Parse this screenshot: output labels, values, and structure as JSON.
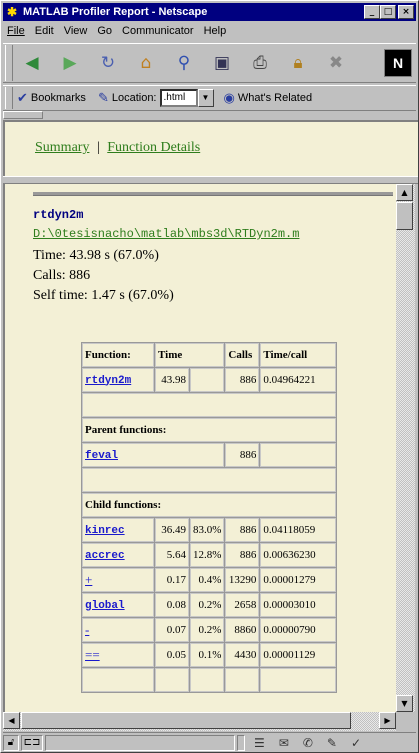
{
  "window": {
    "title": "MATLAB Profiler Report - Netscape"
  },
  "menu": [
    "File",
    "Edit",
    "View",
    "Go",
    "Communicator",
    "Help"
  ],
  "toolbar": {
    "icons": [
      "back-icon",
      "forward-icon",
      "reload-icon",
      "home-icon",
      "search-icon",
      "netscape-guide-icon",
      "print-icon",
      "security-icon",
      "stop-icon"
    ],
    "netscape_logo": "N"
  },
  "location_bar": {
    "bookmarks_label": "Bookmarks",
    "location_label": "Location:",
    "location_value": ".html",
    "whats_related_label": "What's Related"
  },
  "nav_links": {
    "summary": "Summary",
    "separator": "|",
    "function_details": "Function Details"
  },
  "function": {
    "name": "rtdyn2m",
    "path": "D:\\0tesisnacho\\matlab\\mbs3d\\RTDyn2m.m",
    "time_line": "Time: 43.98 s   (67.0%)",
    "calls_line": "Calls: 886",
    "self_time_line": "Self time: 1.47 s   (67.0%)"
  },
  "table": {
    "headers": [
      "Function:",
      "Time",
      "Calls",
      "Time/call"
    ],
    "main_row": {
      "name": "rtdyn2m",
      "time": "43.98",
      "pct": "",
      "calls": "886",
      "time_per_call": "0.04964221"
    },
    "parent_header": "Parent functions:",
    "parents": [
      {
        "name": "feval",
        "calls": "886"
      }
    ],
    "child_header": "Child functions:",
    "children": [
      {
        "name": "kinrec",
        "time": "36.49",
        "pct": "83.0%",
        "calls": "886",
        "time_per_call": "0.04118059",
        "mono": true
      },
      {
        "name": "accrec",
        "time": "5.64",
        "pct": "12.8%",
        "calls": "886",
        "time_per_call": "0.00636230",
        "mono": true
      },
      {
        "name": "+",
        "time": "0.17",
        "pct": "0.4%",
        "calls": "13290",
        "time_per_call": "0.00001279",
        "mono": false
      },
      {
        "name": "global",
        "time": "0.08",
        "pct": "0.2%",
        "calls": "2658",
        "time_per_call": "0.00003010",
        "mono": true
      },
      {
        "name": "-",
        "time": "0.07",
        "pct": "0.2%",
        "calls": "8860",
        "time_per_call": "0.00000790",
        "mono": false
      },
      {
        "name": "==",
        "time": "0.05",
        "pct": "0.1%",
        "calls": "4430",
        "time_per_call": "0.00001129",
        "mono": false
      }
    ]
  },
  "colors": {
    "page_bg": "#f3f0d6",
    "link_green": "#2e7d1c",
    "link_blue": "#1a1acc",
    "title_bar": "#000080"
  }
}
